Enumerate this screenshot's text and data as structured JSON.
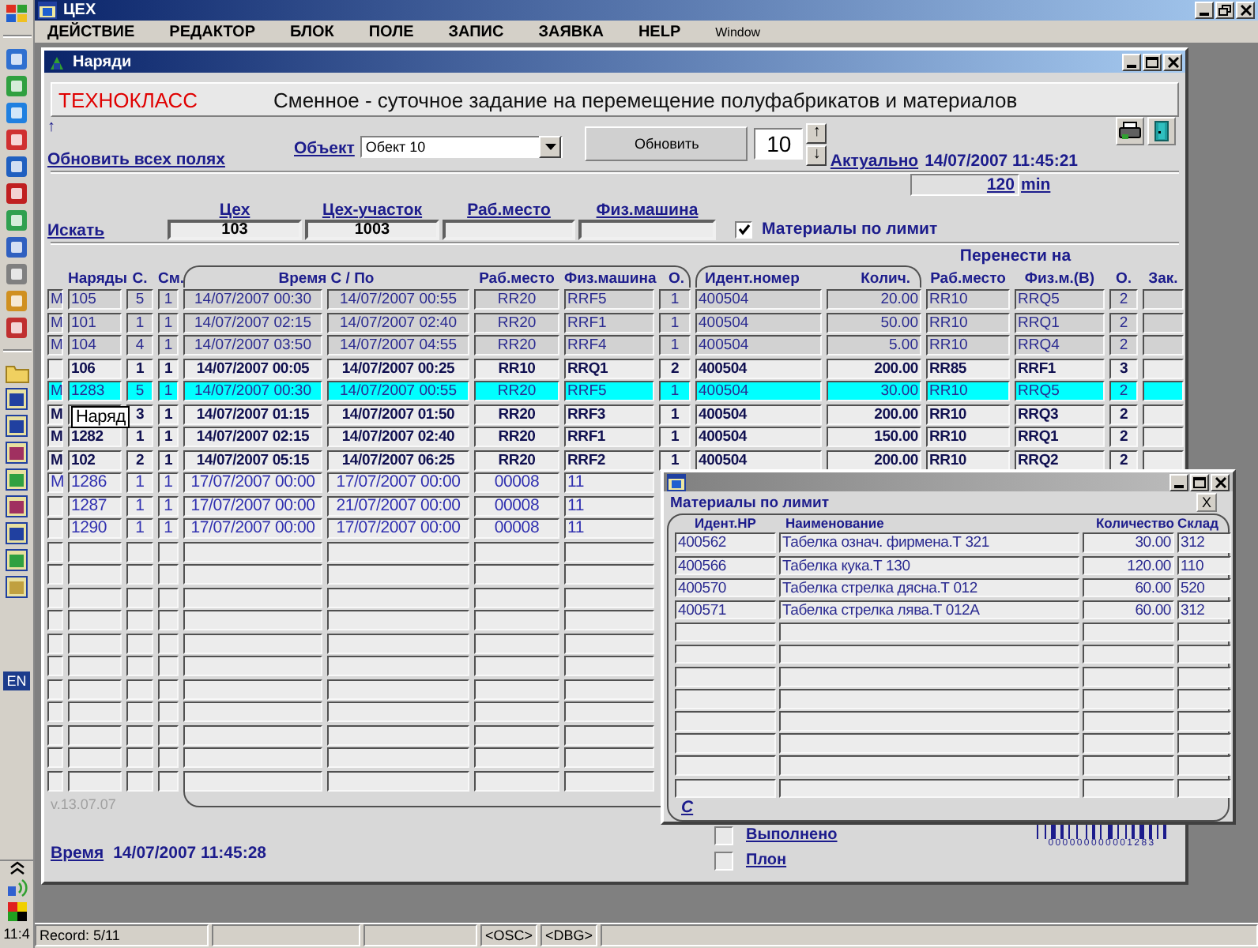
{
  "taskbar": {
    "language": "EN",
    "clock": "11:4"
  },
  "app": {
    "title": "ЦЕХ",
    "menu": [
      "ДЕЙСТВИЕ",
      "РЕДАКТОР",
      "БЛОК",
      "ПОЛЕ",
      "ЗАПИС",
      "ЗАЯВКА",
      "HELP",
      "Window"
    ]
  },
  "window": {
    "title": "Наряди"
  },
  "banner": {
    "brand": "ТЕХНОКЛАСС",
    "heading": "Сменное - суточное задание на перемещение полуфабрикатов и материалов"
  },
  "toolbar": {
    "arrow": "↑",
    "refresh_all_link": "Обновить всех полях",
    "object_label": "Объект",
    "object_value": "Обект 10",
    "refresh_button": "Обновить",
    "count": "10",
    "up": "↑",
    "down": "↓",
    "actual_label": "Актуально",
    "actual_time": "14/07/2007 11:45:21",
    "minutes": "120",
    "minutes_unit": "min"
  },
  "filters": {
    "search_link": "Искать",
    "fields": [
      {
        "label": "Цех",
        "value": "103"
      },
      {
        "label": "Цех-участок",
        "value": "1003"
      },
      {
        "label": "Раб.место"
      },
      {
        "label": "Физ.машина"
      }
    ],
    "limit_checkbox": {
      "label": "Материалы по лимит",
      "checked": true
    }
  },
  "table": {
    "transfer_heading": "Перенести на",
    "columns": [
      "Наряды",
      "С.",
      "См.",
      "Время С / По",
      "Раб.место",
      "Физ.машина",
      "О.",
      "Идент.номер",
      "Колич.",
      "Раб.место",
      "Физ.м.(В)",
      "О.",
      "Зак."
    ],
    "rows": [
      {
        "kind": "closed",
        "selected": false,
        "flag": "M",
        "order": "105",
        "c": "5",
        "shift": "1",
        "from": "14/07/2007 00:30",
        "to": "14/07/2007 00:55",
        "workplace": "RR20",
        "machine": "RRF5",
        "o": "1",
        "item": "400504",
        "qty": "20.00",
        "to_workplace": "RR10",
        "to_machine": "RRQ5",
        "to_o": "2"
      },
      {
        "kind": "closed",
        "selected": false,
        "flag": "M",
        "order": "101",
        "c": "1",
        "shift": "1",
        "from": "14/07/2007 02:15",
        "to": "14/07/2007 02:40",
        "workplace": "RR20",
        "machine": "RRF1",
        "o": "1",
        "item": "400504",
        "qty": "50.00",
        "to_workplace": "RR10",
        "to_machine": "RRQ1",
        "to_o": "2"
      },
      {
        "kind": "closed",
        "selected": false,
        "flag": "M",
        "order": "104",
        "c": "4",
        "shift": "1",
        "from": "14/07/2007 03:50",
        "to": "14/07/2007 04:55",
        "workplace": "RR20",
        "machine": "RRF4",
        "o": "1",
        "item": "400504",
        "qty": "5.00",
        "to_workplace": "RR10",
        "to_machine": "RRQ4",
        "to_o": "2"
      },
      {
        "kind": "open",
        "selected": false,
        "order": "106",
        "c": "1",
        "shift": "1",
        "from": "14/07/2007 00:05",
        "to": "14/07/2007 00:25",
        "workplace": "RR10",
        "machine": "RRQ1",
        "o": "2",
        "item": "400504",
        "qty": "200.00",
        "to_workplace": "RR85",
        "to_machine": "RRF1",
        "to_o": "3"
      },
      {
        "kind": "closed",
        "selected": true,
        "flag": "M",
        "order": "1283",
        "c": "5",
        "shift": "1",
        "from": "14/07/2007 00:30",
        "to": "14/07/2007 00:55",
        "workplace": "RR20",
        "machine": "RRF5",
        "o": "1",
        "item": "400504",
        "qty": "30.00",
        "to_workplace": "RR10",
        "to_machine": "RRQ5",
        "to_o": "2"
      },
      {
        "kind": "open",
        "selected": false,
        "flag": "M",
        "tooltip": "Наряд",
        "c": "3",
        "shift": "1",
        "from": "14/07/2007 01:15",
        "to": "14/07/2007 01:50",
        "workplace": "RR20",
        "machine": "RRF3",
        "o": "1",
        "item": "400504",
        "qty": "200.00",
        "to_workplace": "RR10",
        "to_machine": "RRQ3",
        "to_o": "2"
      },
      {
        "kind": "open",
        "selected": false,
        "flag": "M",
        "order": "1282",
        "c": "1",
        "shift": "1",
        "from": "14/07/2007 02:15",
        "to": "14/07/2007 02:40",
        "workplace": "RR20",
        "machine": "RRF1",
        "o": "1",
        "item": "400504",
        "qty": "150.00",
        "to_workplace": "RR10",
        "to_machine": "RRQ1",
        "to_o": "2"
      },
      {
        "kind": "open",
        "selected": false,
        "flag": "M",
        "order": "102",
        "c": "2",
        "shift": "1",
        "from": "14/07/2007 05:15",
        "to": "14/07/2007 06:25",
        "workplace": "RR20",
        "machine": "RRF2",
        "o": "1",
        "item": "400504",
        "qty": "200.00",
        "to_workplace": "RR10",
        "to_machine": "RRQ2",
        "to_o": "2"
      },
      {
        "kind": "planned",
        "selected": false,
        "flag": "M",
        "order": "1286",
        "c": "1",
        "shift": "1",
        "from": "17/07/2007 00:00",
        "to": "17/07/2007 00:00",
        "workplace": "00008",
        "machine": "11"
      },
      {
        "kind": "planned",
        "selected": false,
        "order": "1287",
        "c": "1",
        "shift": "1",
        "from": "17/07/2007 00:00",
        "to": "21/07/2007 00:00",
        "workplace": "00008",
        "machine": "11"
      },
      {
        "kind": "planned",
        "selected": false,
        "order": "1290",
        "c": "1",
        "shift": "1",
        "from": "17/07/2007 00:00",
        "to": "17/07/2007 00:00",
        "workplace": "00008",
        "machine": "11"
      }
    ]
  },
  "popup": {
    "heading": "Материалы по лимит",
    "close_button": "X",
    "columns": [
      "Идент.НР",
      "Наименование",
      "Количество",
      "Склад"
    ],
    "rows": [
      {
        "id": "400562",
        "name": "Табелка означ. фирмена.Т 321",
        "qty": "30.00",
        "store": "312"
      },
      {
        "id": "400566",
        "name": "Табелка кука.Т 130",
        "qty": "120.00",
        "store": "110"
      },
      {
        "id": "400570",
        "name": "Табелка стрелка дясна.Т 012",
        "qty": "60.00",
        "store": "520"
      },
      {
        "id": "400571",
        "name": "Табелка стрелка лява.Т 012А",
        "qty": "60.00",
        "store": "312"
      }
    ],
    "footer_link": "С"
  },
  "footer": {
    "version": "v.13.07.07",
    "time_label": "Время",
    "time": "14/07/2007 11:45:28",
    "checks": [
      {
        "label": "Выполнено",
        "checked": false
      },
      {
        "label": "Плон",
        "checked": false
      }
    ],
    "barcode_digits": "000000000001283"
  },
  "status_bar": {
    "record": "Record: 5/11",
    "flags": [
      "<OSC>",
      "<DBG>"
    ]
  }
}
